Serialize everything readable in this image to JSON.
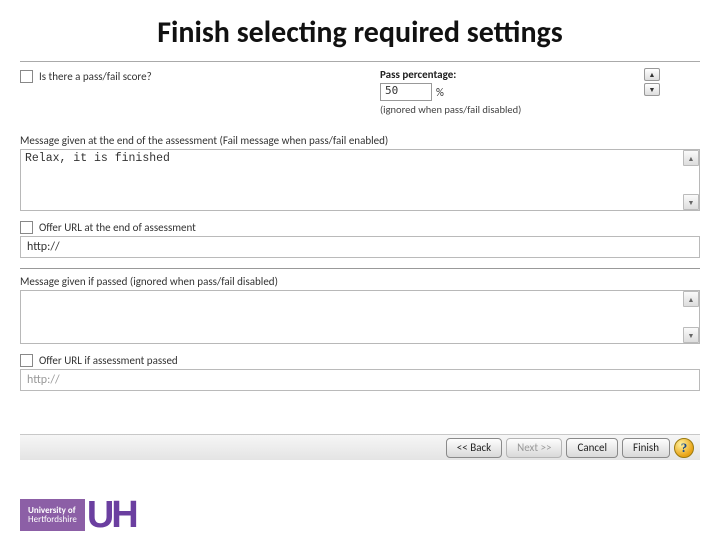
{
  "title": "Finish selecting required settings",
  "passfail": {
    "checkbox_label": "Is there a pass/fail score?",
    "pct_label": "Pass percentage:",
    "pct_value": "50",
    "pct_unit": "%",
    "hint": "(ignored when pass/fail disabled)"
  },
  "end_message": {
    "label": "Message given at the end of the assessment (Fail message when pass/fail enabled)",
    "value": "Relax, it is finished"
  },
  "offer_url_end": {
    "label": "Offer URL at the end of assessment",
    "value": "http://"
  },
  "pass_message": {
    "label": "Message given if passed  (ignored when pass/fail disabled)",
    "value": ""
  },
  "offer_url_pass": {
    "label": "Offer URL if assessment passed",
    "value": "http://"
  },
  "buttons": {
    "back": "<< Back",
    "next": "Next >>",
    "cancel": "Cancel",
    "finish": "Finish",
    "help": "?"
  },
  "brand": {
    "line1": "University of",
    "line2": "Hertfordshire",
    "mark": "UH"
  }
}
